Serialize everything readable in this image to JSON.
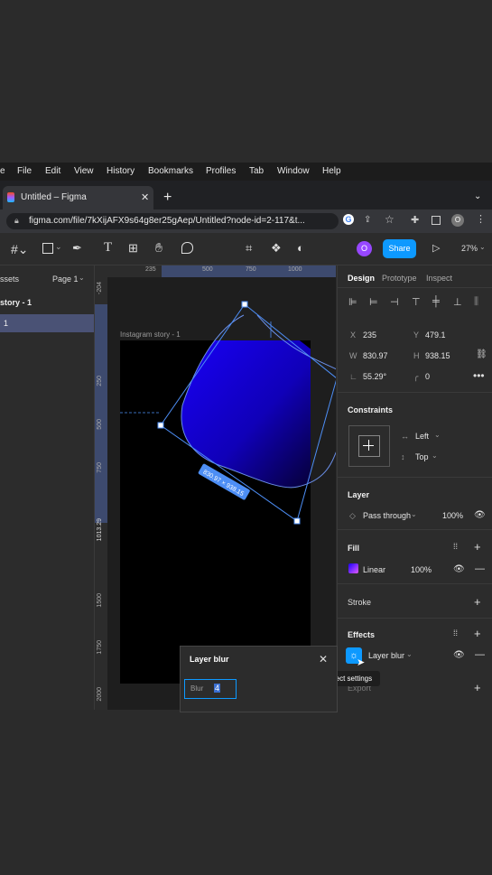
{
  "menu": [
    "File",
    "Edit",
    "View",
    "History",
    "Bookmarks",
    "Profiles",
    "Tab",
    "Window",
    "Help"
  ],
  "menu_leading": "e",
  "browser_tab": {
    "title": "Untitled – Figma"
  },
  "url": "figma.com/file/7kXijAFX9s64g8er25gAep/Untitled?node-id=2-117&t...",
  "toolbar": {
    "share": "Share",
    "zoom": "27%",
    "avatar": "O",
    "profile": "O"
  },
  "left_panel": {
    "assets": "ssets",
    "page": "Page 1",
    "layer1": "story - 1",
    "layer2": "1"
  },
  "ruler_top": [
    "235",
    "500",
    "750",
    "1000"
  ],
  "ruler_left": [
    "-204",
    "250",
    "500",
    "750",
    "1013.29",
    "1500",
    "1750",
    "2000"
  ],
  "canvas": {
    "frame_label": "Instagram story - 1",
    "size_label": "830.97 × 938.15"
  },
  "panel_tabs": {
    "design": "Design",
    "prototype": "Prototype",
    "inspect": "Inspect"
  },
  "props": {
    "x_label": "X",
    "x": "235",
    "y_label": "Y",
    "y": "479.1",
    "w_label": "W",
    "w": "830.97",
    "h_label": "H",
    "h": "938.15",
    "rotation": "55.29°",
    "radius": "0"
  },
  "constraints": {
    "title": "Constraints",
    "h": "Left",
    "v": "Top"
  },
  "layer": {
    "title": "Layer",
    "blend": "Pass through",
    "opacity": "100%"
  },
  "fill": {
    "title": "Fill",
    "type": "Linear",
    "opacity": "100%"
  },
  "stroke": {
    "title": "Stroke"
  },
  "effects": {
    "title": "Effects",
    "item": "Layer blur"
  },
  "export": {
    "title": "Export"
  },
  "tooltip": "Effect settings",
  "popup": {
    "title": "Layer blur",
    "field_label": "Blur",
    "value": "4"
  },
  "colors": {
    "accent": "#0d99ff",
    "brand_purple": "#9747ff",
    "fill_top": "#1a00ff",
    "fill_bottom": "#04001a"
  }
}
